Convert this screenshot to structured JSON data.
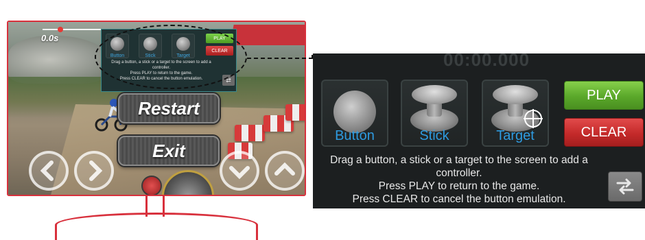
{
  "game": {
    "timer": "0.0s",
    "restart_label": "Restart",
    "exit_label": "Exit",
    "controls": {
      "left_icon": "chevron-left-icon",
      "right_icon": "chevron-right-icon",
      "down_icon": "chevron-down-icon",
      "up_icon": "chevron-up-icon"
    }
  },
  "controller_overlay": {
    "slots": [
      {
        "label": "Button",
        "icon": "ball-button-icon"
      },
      {
        "label": "Stick",
        "icon": "joystick-icon"
      },
      {
        "label": "Target",
        "icon": "joystick-target-icon"
      }
    ],
    "play_label": "PLAY",
    "clear_label": "CLEAR",
    "help_line1": "Drag a button, a stick or a target to the screen to add a controller.",
    "help_line2": "Press PLAY to return to the game.",
    "help_line3": "Press CLEAR to cancel the button emulation.",
    "swap_icon": "swap-arrows-icon"
  },
  "colors": {
    "tv_frame": "#d8303c",
    "label_blue": "#2e9be0",
    "play_green": "#5aa82a",
    "clear_red": "#c42a2a",
    "panel_bg": "#1c1f20"
  }
}
